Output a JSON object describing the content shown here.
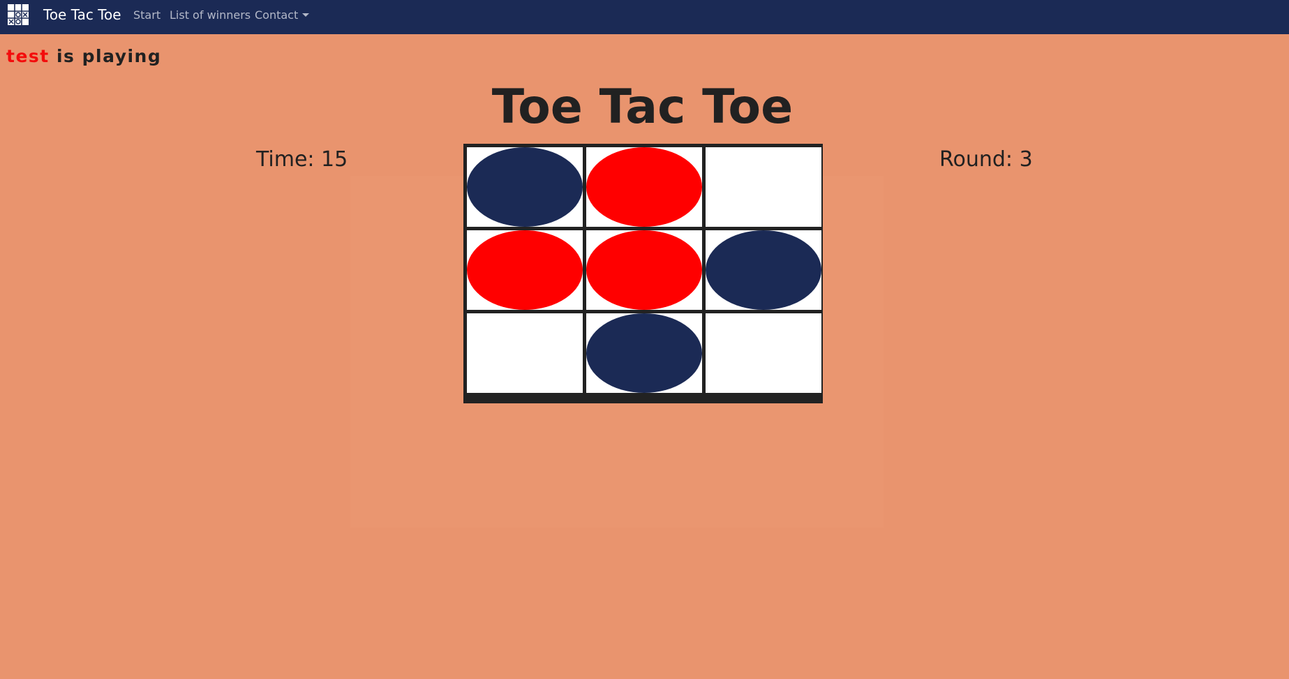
{
  "nav": {
    "logo_icon": "tic-tac-toe-grid-icon",
    "brand": "Toe Tac Toe",
    "links": [
      "Start",
      "List of winners",
      "Contact"
    ]
  },
  "status": {
    "player": "test",
    "suffix": "is playing"
  },
  "game": {
    "title": "Toe Tac Toe",
    "time_label": "Time: 15",
    "round_label": "Round: 3",
    "board": [
      [
        "blue",
        "red",
        ""
      ],
      [
        "red",
        "red",
        "blue"
      ],
      [
        "",
        "blue",
        ""
      ]
    ]
  },
  "colors": {
    "background": "#E9946E",
    "navbar": "#1B2A55",
    "blue": "#1B2A55",
    "red": "#FF0000",
    "player_name": "#F30C0C"
  }
}
